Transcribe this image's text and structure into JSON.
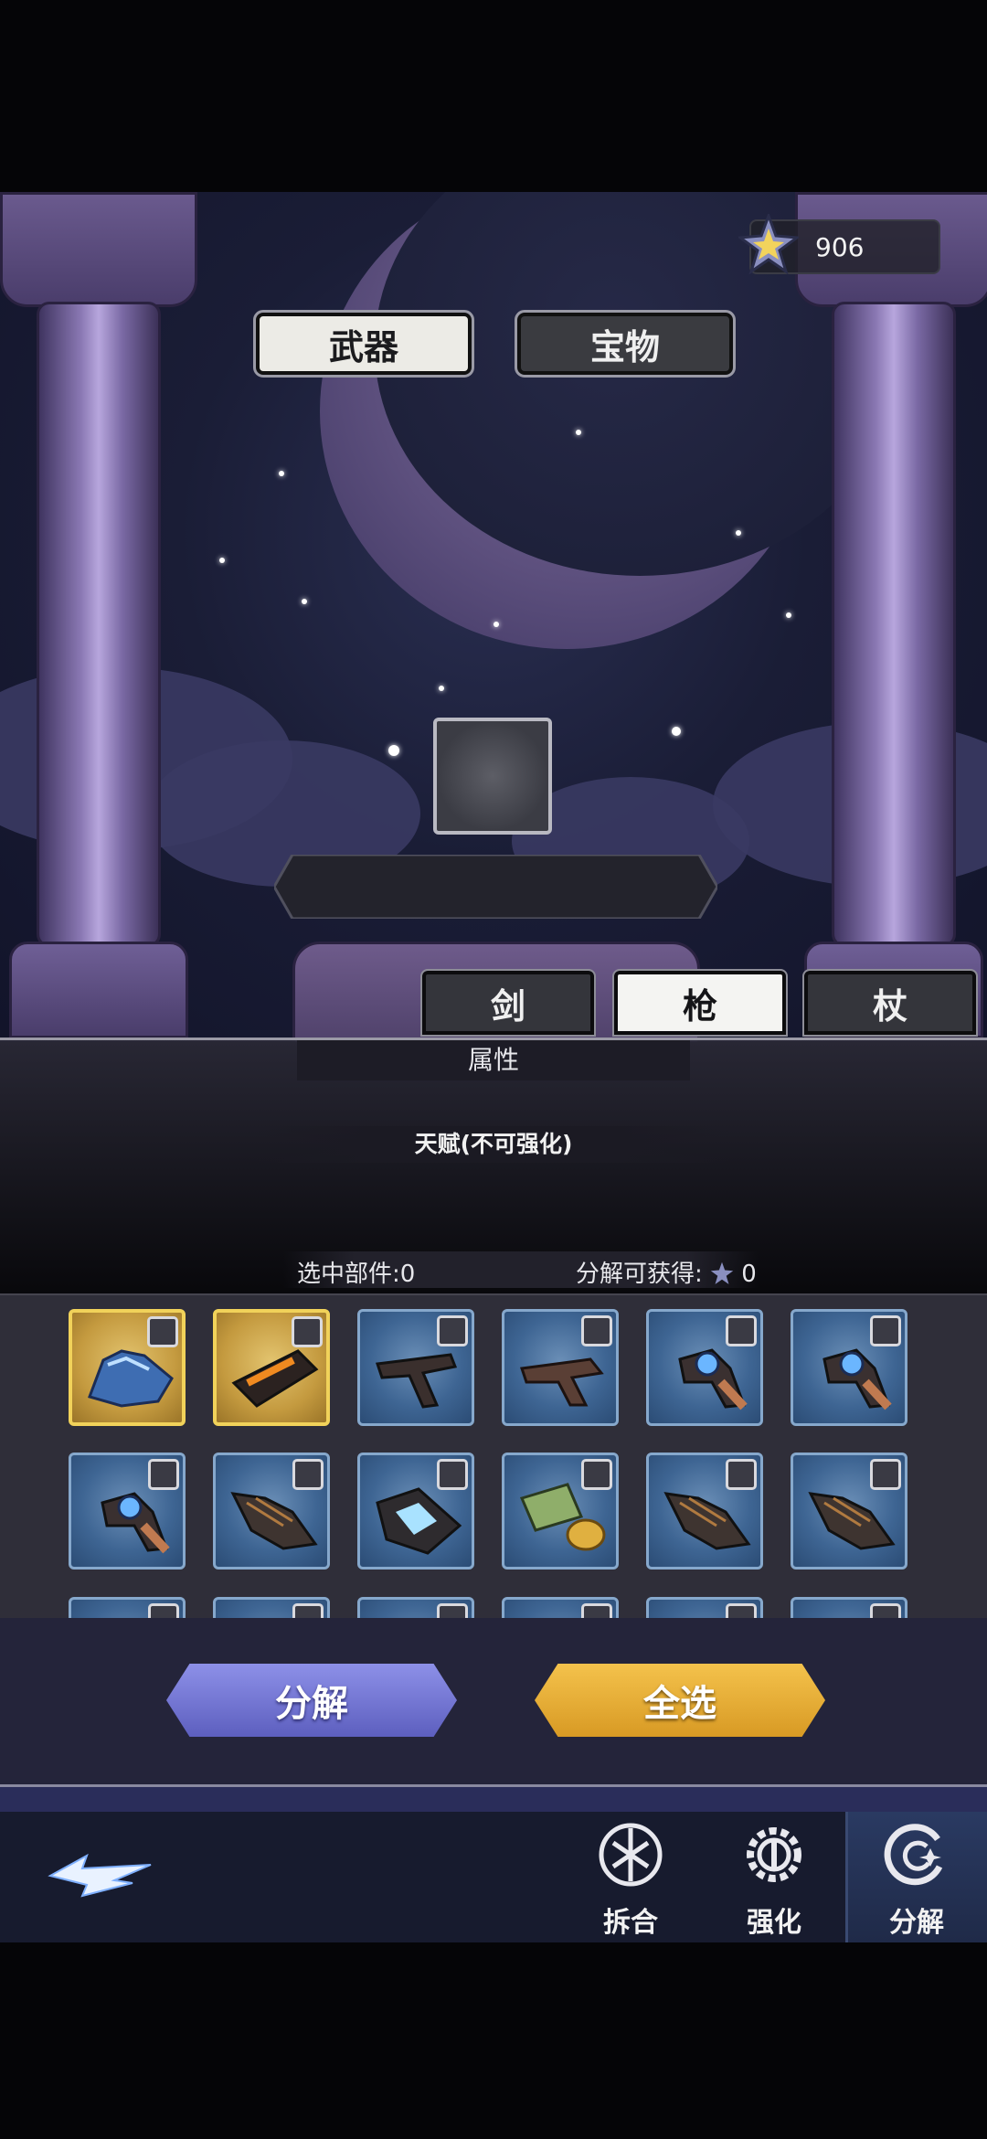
{
  "currency": {
    "icon": "star-gem-icon",
    "value": "906"
  },
  "main_tabs": [
    {
      "label": "武器",
      "active": true
    },
    {
      "label": "宝物",
      "active": false
    }
  ],
  "weapon_tabs": [
    {
      "label": "剑",
      "active": false
    },
    {
      "label": "枪",
      "active": true
    },
    {
      "label": "杖",
      "active": false
    }
  ],
  "attributes": {
    "header": "属性",
    "talent": "天赋(不可强化)"
  },
  "selection": {
    "selected_label": "选中部件:0",
    "gain_label": "分解可获得:",
    "gain_value": "0"
  },
  "items": [
    {
      "rarity": "gold",
      "icon": "blue-crystal-claw-icon"
    },
    {
      "rarity": "gold",
      "icon": "flame-blade-icon"
    },
    {
      "rarity": "blue",
      "icon": "dark-gun-icon"
    },
    {
      "rarity": "blue",
      "icon": "root-gun-icon"
    },
    {
      "rarity": "blue",
      "icon": "orb-staff-icon"
    },
    {
      "rarity": "blue",
      "icon": "orb-staff-icon"
    },
    {
      "rarity": "blue",
      "icon": "orb-staff-icon"
    },
    {
      "rarity": "blue",
      "icon": "spiked-claw-icon"
    },
    {
      "rarity": "blue",
      "icon": "crystal-shield-icon"
    },
    {
      "rarity": "blue",
      "icon": "leaf-cone-icon"
    },
    {
      "rarity": "blue",
      "icon": "spiked-claw-icon"
    },
    {
      "rarity": "blue",
      "icon": "spiked-claw-icon"
    }
  ],
  "buttons": {
    "decompose": "分解",
    "select_all": "全选"
  },
  "nav": [
    {
      "label": "拆合",
      "icon": "dismantle-icon",
      "active": false
    },
    {
      "label": "强化",
      "icon": "enhance-gear-icon",
      "active": false
    },
    {
      "label": "分解",
      "icon": "decompose-swirl-icon",
      "active": true
    }
  ],
  "colors": {
    "accent_gold": "#f1d25a",
    "accent_purple": "#7d80dd",
    "item_blue": "#3e6593"
  }
}
